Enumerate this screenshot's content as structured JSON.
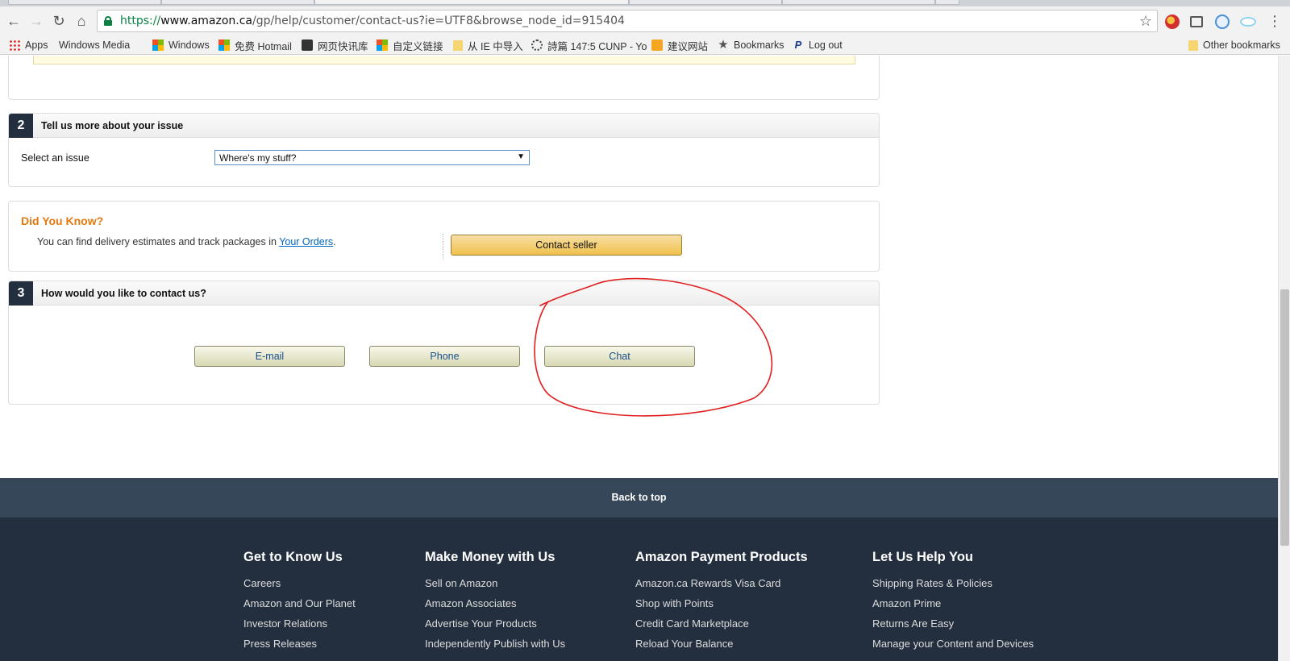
{
  "browser": {
    "url_scheme": "https://",
    "url_host": "www.amazon.ca",
    "url_path": "/gp/help/customer/contact-us?ie=UTF8&browse_node_id=915404",
    "nav": {
      "back": "←",
      "forward": "→",
      "reload": "↻",
      "home": "⌂"
    },
    "bookmarks": [
      {
        "label": "Apps",
        "icon": "apps-grid-icon"
      },
      {
        "label": "Windows Media",
        "icon": "page-icon"
      },
      {
        "label": "Windows",
        "icon": "windows-logo-icon"
      },
      {
        "label": "免费 Hotmail",
        "icon": "windows-logo-icon"
      },
      {
        "label": "网页快讯库",
        "icon": "feed-icon"
      },
      {
        "label": "自定义链接",
        "icon": "windows-logo-icon"
      },
      {
        "label": "从 IE 中导入",
        "icon": "folder-icon"
      },
      {
        "label": "詩篇 147:5 CUNP - Yo",
        "icon": "loading-icon"
      },
      {
        "label": "建议网站",
        "icon": "bing-icon"
      },
      {
        "label": "Bookmarks",
        "icon": "star-icon"
      },
      {
        "label": "Log out",
        "icon": "paypal-icon"
      }
    ],
    "other_bookmarks": "Other bookmarks"
  },
  "step2": {
    "number": "2",
    "title": "Tell us more about your issue",
    "select_label": "Select an issue",
    "select_value": "Where's my stuff?"
  },
  "did_you_know": {
    "title": "Did You Know?",
    "text": "You can find delivery estimates and track packages in ",
    "link": "Your Orders",
    "after_link": ".",
    "button": "Contact seller"
  },
  "step3": {
    "number": "3",
    "title": "How would you like to contact us?",
    "buttons": [
      "E-mail",
      "Phone",
      "Chat"
    ]
  },
  "back_to_top": "Back to top",
  "footer": {
    "columns": [
      {
        "heading": "Get to Know Us",
        "links": [
          "Careers",
          "Amazon and Our Planet",
          "Investor Relations",
          "Press Releases"
        ]
      },
      {
        "heading": "Make Money with Us",
        "links": [
          "Sell on Amazon",
          "Amazon Associates",
          "Advertise Your Products",
          "Independently Publish with Us"
        ]
      },
      {
        "heading": "Amazon Payment Products",
        "links": [
          "Amazon.ca Rewards Visa Card",
          "Shop with Points",
          "Credit Card Marketplace",
          "Reload Your Balance"
        ]
      },
      {
        "heading": "Let Us Help You",
        "links": [
          "Shipping Rates & Policies",
          "Amazon Prime",
          "Returns Are Easy",
          "Manage your Content and Devices"
        ]
      }
    ]
  },
  "colors": {
    "accent_orange": "#e47911",
    "link_blue": "#0066c0",
    "footer_bg": "#232f3e",
    "back_to_top_bg": "#37475a",
    "annotation_red": "#e02020"
  }
}
